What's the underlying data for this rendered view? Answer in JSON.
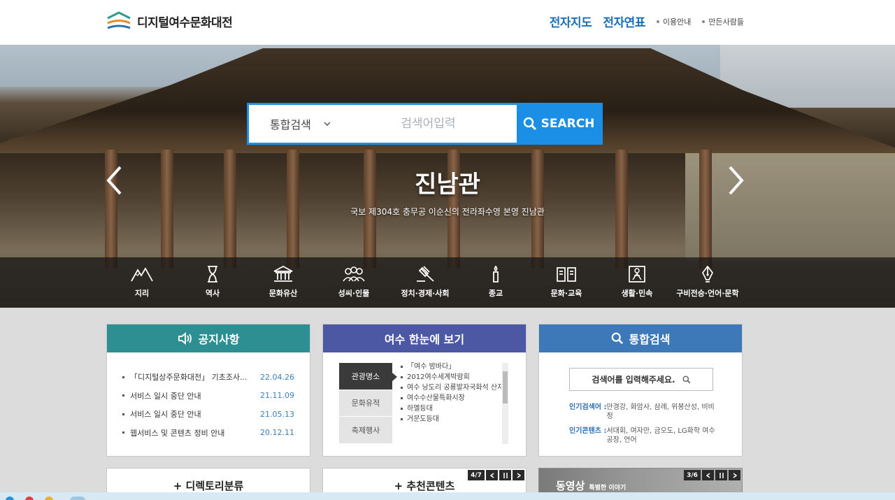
{
  "header": {
    "logo_text": "디지털여수문화대전",
    "nav": [
      {
        "label": "전자지도",
        "size": "big"
      },
      {
        "label": "전자연표",
        "size": "big"
      },
      {
        "label": "이용안내",
        "size": "small"
      },
      {
        "label": "만든사람들",
        "size": "small"
      }
    ]
  },
  "hero": {
    "search_select": "통합검색",
    "search_placeholder": "검색어입력",
    "search_button": "SEARCH",
    "title": "진남관",
    "subtitle": "국보 제304호 충무공 이순신의 전라좌수영 본영 진남관",
    "categories": [
      {
        "label": "지리",
        "icon": "mountain-icon"
      },
      {
        "label": "역사",
        "icon": "hourglass-icon"
      },
      {
        "label": "문화유산",
        "icon": "temple-icon"
      },
      {
        "label": "성씨·인물",
        "icon": "people-icon"
      },
      {
        "label": "정치·경제·사회",
        "icon": "gavel-icon"
      },
      {
        "label": "종교",
        "icon": "candle-icon"
      },
      {
        "label": "문화·교육",
        "icon": "book-icon"
      },
      {
        "label": "생활·민속",
        "icon": "folk-icon"
      },
      {
        "label": "구비전승·언어·문학",
        "icon": "pen-icon"
      }
    ]
  },
  "notice": {
    "title": "공지사항",
    "items": [
      {
        "title": "「디지털상주문화대전」 기초조사...",
        "date": "22.04.26"
      },
      {
        "title": "서비스 일시 중단 안내",
        "date": "21.11.09"
      },
      {
        "title": "서비스 일시 중단 안내",
        "date": "21.05.13"
      },
      {
        "title": "웹서비스 및 콘텐츠 정비 안내",
        "date": "20.12.11"
      }
    ]
  },
  "overview": {
    "title": "여수 한눈에 보기",
    "tabs": [
      "관광명소",
      "문화유적",
      "축제행사"
    ],
    "items": [
      "「여수 밤바다」",
      "2012여수세계박람회",
      "여수 낭도리 공룡발자국화석 산지",
      "여수수산물특화시장",
      "하멜등대",
      "거문도등대"
    ]
  },
  "gsearch": {
    "title": "통합검색",
    "placeholder": "검색어를 입력해주세요.",
    "popular_search_label": "인기검색어 :",
    "popular_search": "만경강, 화암사, 삼례, 위봉산성, 비비정",
    "popular_content_label": "인기콘텐츠 :",
    "popular_content": "서대회, 여자만, 금오도, LG화학 여수공장, 언어"
  },
  "bottom": {
    "directory": "+ 디렉토리분류",
    "recommend": "+ 추천콘텐츠",
    "recommend_pager": "4/7",
    "video": "동영상",
    "video_sub": "특별한 이야기",
    "video_pager": "3/6"
  },
  "colors": {
    "notice": "#2e8f92",
    "overview": "#4c58a4",
    "gsearch": "#3d78b8",
    "accent": "#1b8fe6"
  }
}
